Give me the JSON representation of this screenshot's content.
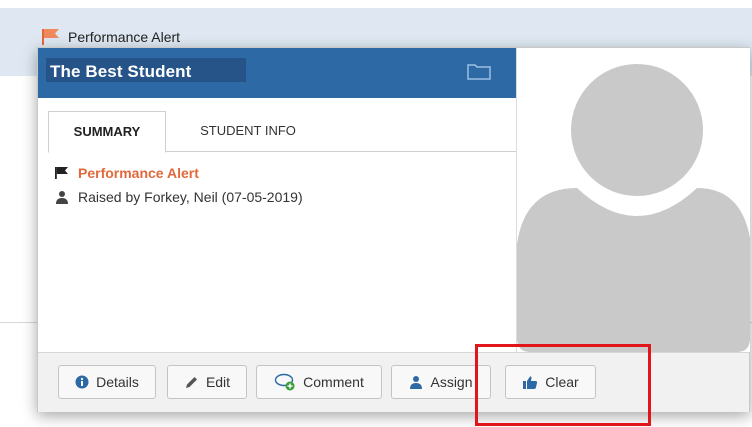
{
  "background": {
    "alert_row_label": "Performance Alert"
  },
  "popover": {
    "title": "The Best Student",
    "tabs": [
      {
        "label": "SUMMARY",
        "active": true
      },
      {
        "label": "STUDENT INFO",
        "active": false
      }
    ],
    "alert_label": "Performance Alert",
    "raised_by": "Raised by Forkey, Neil (07-05-2019)"
  },
  "footer": {
    "buttons": [
      {
        "label": "Details",
        "icon": "info-icon"
      },
      {
        "label": "Edit",
        "icon": "pencil-icon"
      },
      {
        "label": "Comment",
        "icon": "comment-add-icon"
      },
      {
        "label": "Assign",
        "icon": "user-icon"
      },
      {
        "label": "Clear",
        "icon": "thumbs-up-icon"
      }
    ]
  },
  "colors": {
    "header_blue": "#2d6aa5",
    "alert_orange": "#e1693c",
    "highlight_red": "#e0161c"
  }
}
